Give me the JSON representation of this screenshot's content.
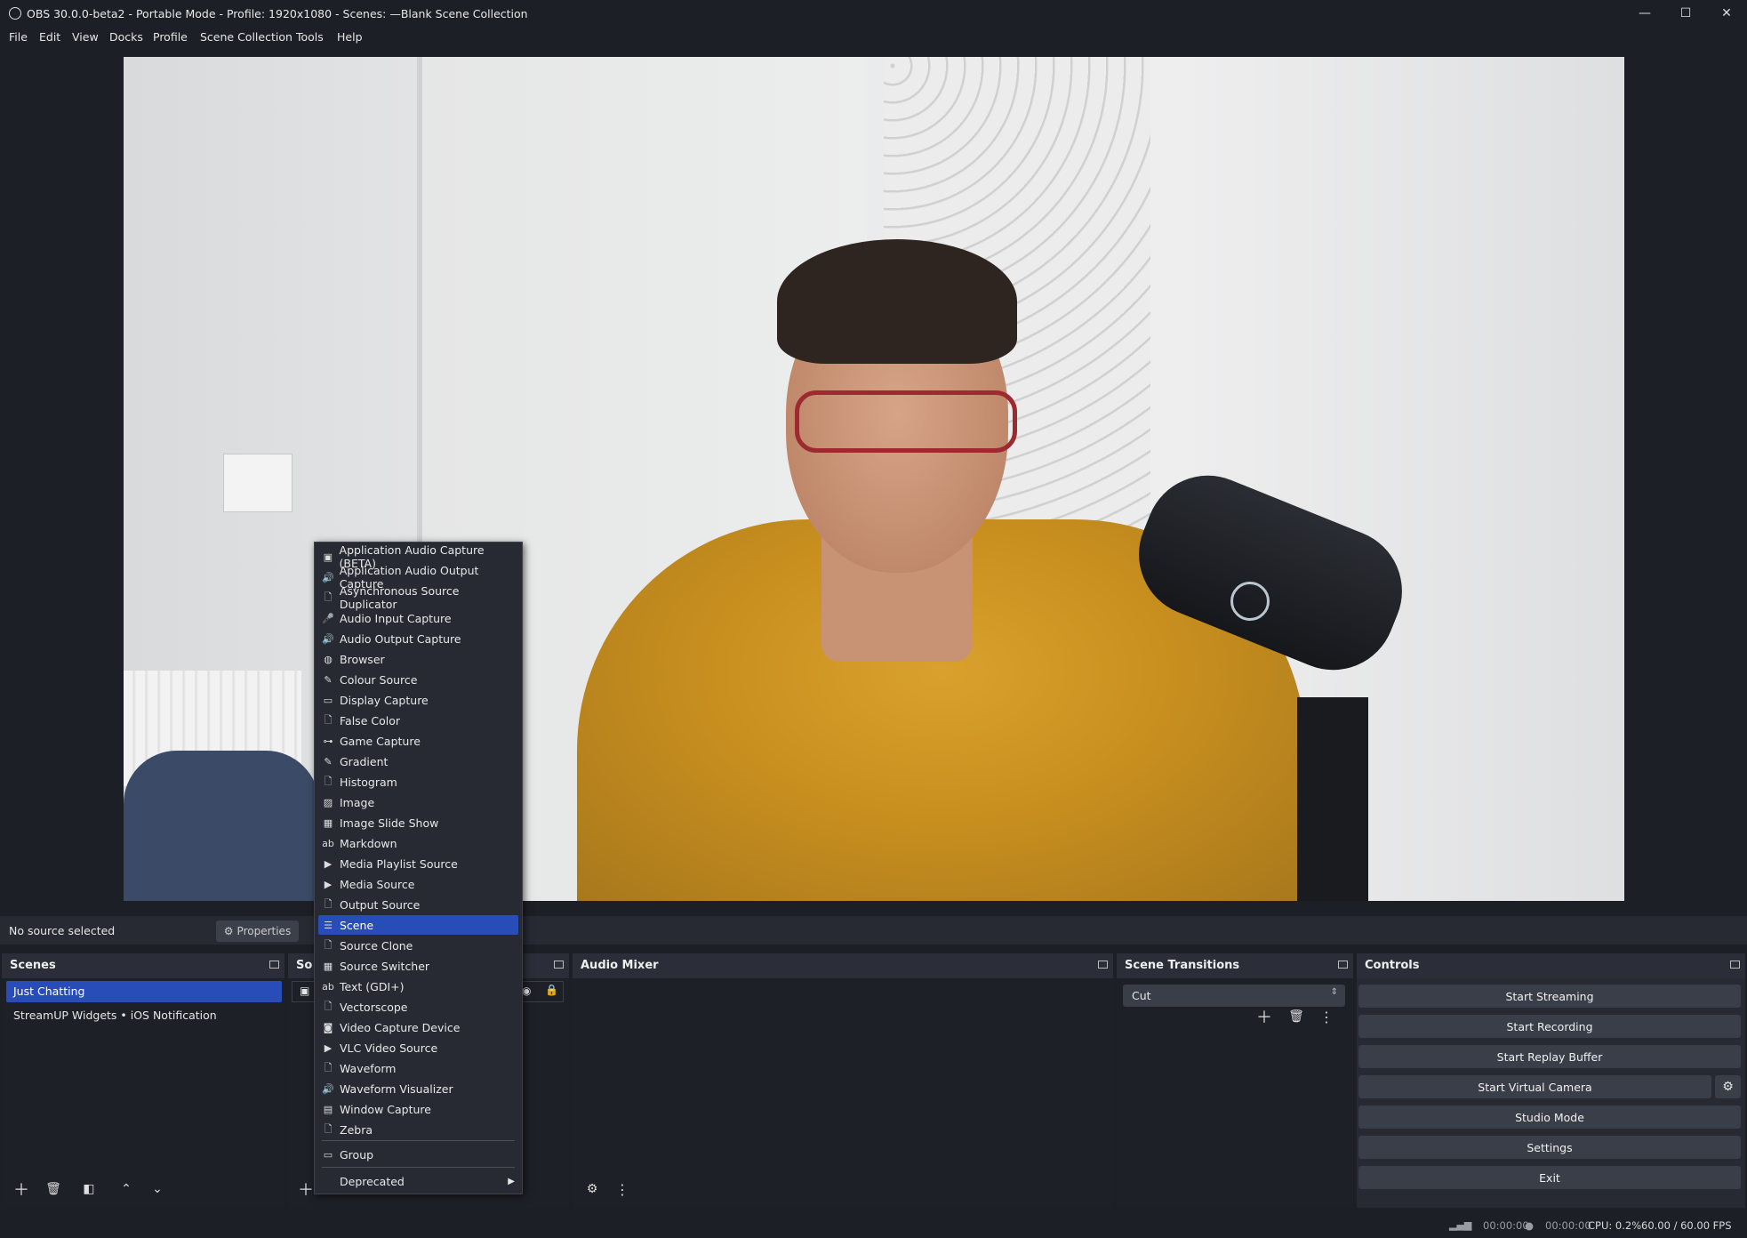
{
  "window": {
    "title": "OBS 30.0.0-beta2 - Portable Mode - Profile: 1920x1080 - Scenes: —Blank Scene Collection",
    "minimize": "—",
    "maximize": "☐",
    "close": "✕"
  },
  "menu": [
    "File",
    "Edit",
    "View",
    "Docks",
    "Profile",
    "Scene Collection",
    "Tools",
    "Help"
  ],
  "source_bar": {
    "status": "No source selected",
    "properties_label": "Properties"
  },
  "docks": {
    "scenes": {
      "title": "Scenes",
      "items": [
        "Just Chatting",
        "StreamUP Widgets • iOS Notification"
      ],
      "selected_index": 0
    },
    "sources": {
      "title": "Sources",
      "title_visible": "So"
    },
    "audio_mixer": {
      "title": "Audio Mixer"
    },
    "scene_transitions": {
      "title": "Scene Transitions",
      "selected": "Cut"
    },
    "controls": {
      "title": "Controls",
      "buttons": [
        "Start Streaming",
        "Start Recording",
        "Start Replay Buffer",
        "Start Virtual Camera",
        "Studio Mode",
        "Settings",
        "Exit"
      ]
    }
  },
  "context_menu": {
    "items": [
      {
        "label": "Application Audio Capture (BETA)",
        "icon": "app-audio-icon"
      },
      {
        "label": "Application Audio Output Capture",
        "icon": "speaker-icon"
      },
      {
        "label": "Asynchronous Source Duplicator",
        "icon": "file-icon"
      },
      {
        "label": "Audio Input Capture",
        "icon": "microphone-icon"
      },
      {
        "label": "Audio Output Capture",
        "icon": "speaker-icon"
      },
      {
        "label": "Browser",
        "icon": "globe-icon"
      },
      {
        "label": "Colour Source",
        "icon": "brush-icon"
      },
      {
        "label": "Display Capture",
        "icon": "monitor-icon"
      },
      {
        "label": "False Color",
        "icon": "file-icon"
      },
      {
        "label": "Game Capture",
        "icon": "gamepad-icon"
      },
      {
        "label": "Gradient",
        "icon": "brush-icon"
      },
      {
        "label": "Histogram",
        "icon": "file-icon"
      },
      {
        "label": "Image",
        "icon": "image-icon"
      },
      {
        "label": "Image Slide Show",
        "icon": "slideshow-icon"
      },
      {
        "label": "Markdown",
        "icon": "text-icon"
      },
      {
        "label": "Media Playlist Source",
        "icon": "play-icon"
      },
      {
        "label": "Media Source",
        "icon": "play-icon"
      },
      {
        "label": "Output Source",
        "icon": "file-icon"
      },
      {
        "label": "Scene",
        "icon": "list-icon"
      },
      {
        "label": "Source Clone",
        "icon": "file-icon"
      },
      {
        "label": "Source Switcher",
        "icon": "slideshow-icon"
      },
      {
        "label": "Text (GDI+)",
        "icon": "text-icon"
      },
      {
        "label": "Vectorscope",
        "icon": "file-icon"
      },
      {
        "label": "Video Capture Device",
        "icon": "camera-icon"
      },
      {
        "label": "VLC Video Source",
        "icon": "play-icon"
      },
      {
        "label": "Waveform",
        "icon": "file-icon"
      },
      {
        "label": "Waveform Visualizer",
        "icon": "speaker-icon"
      },
      {
        "label": "Window Capture",
        "icon": "window-icon"
      },
      {
        "label": "Zebra",
        "icon": "file-icon"
      }
    ],
    "group_label": "Group",
    "deprecated_label": "Deprecated",
    "selected_label": "Scene"
  },
  "status_bar": {
    "stream_time": "00:00:00",
    "record_time": "00:00:00",
    "cpu": "CPU: 0.2%",
    "fps": "60.00 / 60.00 FPS"
  },
  "colors": {
    "accent": "#284cb8",
    "background": "#1d1f26",
    "panel": "#272a33"
  }
}
